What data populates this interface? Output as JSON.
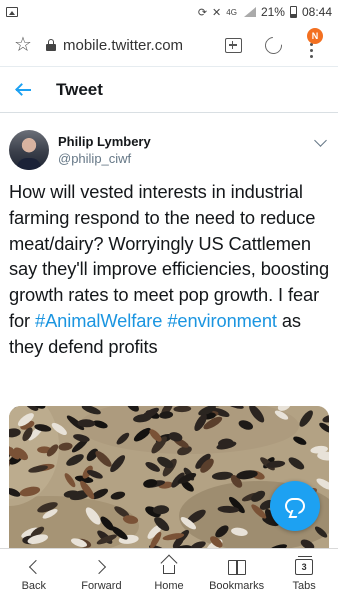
{
  "status_bar": {
    "network": "4G",
    "battery": "21%",
    "time": "08:44"
  },
  "browser": {
    "url": "mobile.twitter.com",
    "notification_badge": "N"
  },
  "header": {
    "title": "Tweet"
  },
  "tweet": {
    "author_name": "Philip Lymbery",
    "author_handle": "@philip_ciwf",
    "text_part1": "How will vested interests in industrial farming respond to the need to reduce meat/dairy? Worryingly US Cattlemen say they'll improve efficiencies, boosting growth rates to meet pop growth. I fear for ",
    "hashtag1": "#AnimalWelfare",
    "hashtag2": "#environment",
    "text_part2": " as they defend profits",
    "link_color": "#1b95e0"
  },
  "compose": {
    "icon": "chat-bubble-icon",
    "color": "#1da1f2"
  },
  "bottom_nav": [
    {
      "label": "Back",
      "icon": "chevron-left-icon"
    },
    {
      "label": "Forward",
      "icon": "chevron-right-icon"
    },
    {
      "label": "Home",
      "icon": "home-icon"
    },
    {
      "label": "Bookmarks",
      "icon": "bookmarks-icon"
    },
    {
      "label": "Tabs",
      "icon": "tabs-icon",
      "count": "3"
    }
  ]
}
